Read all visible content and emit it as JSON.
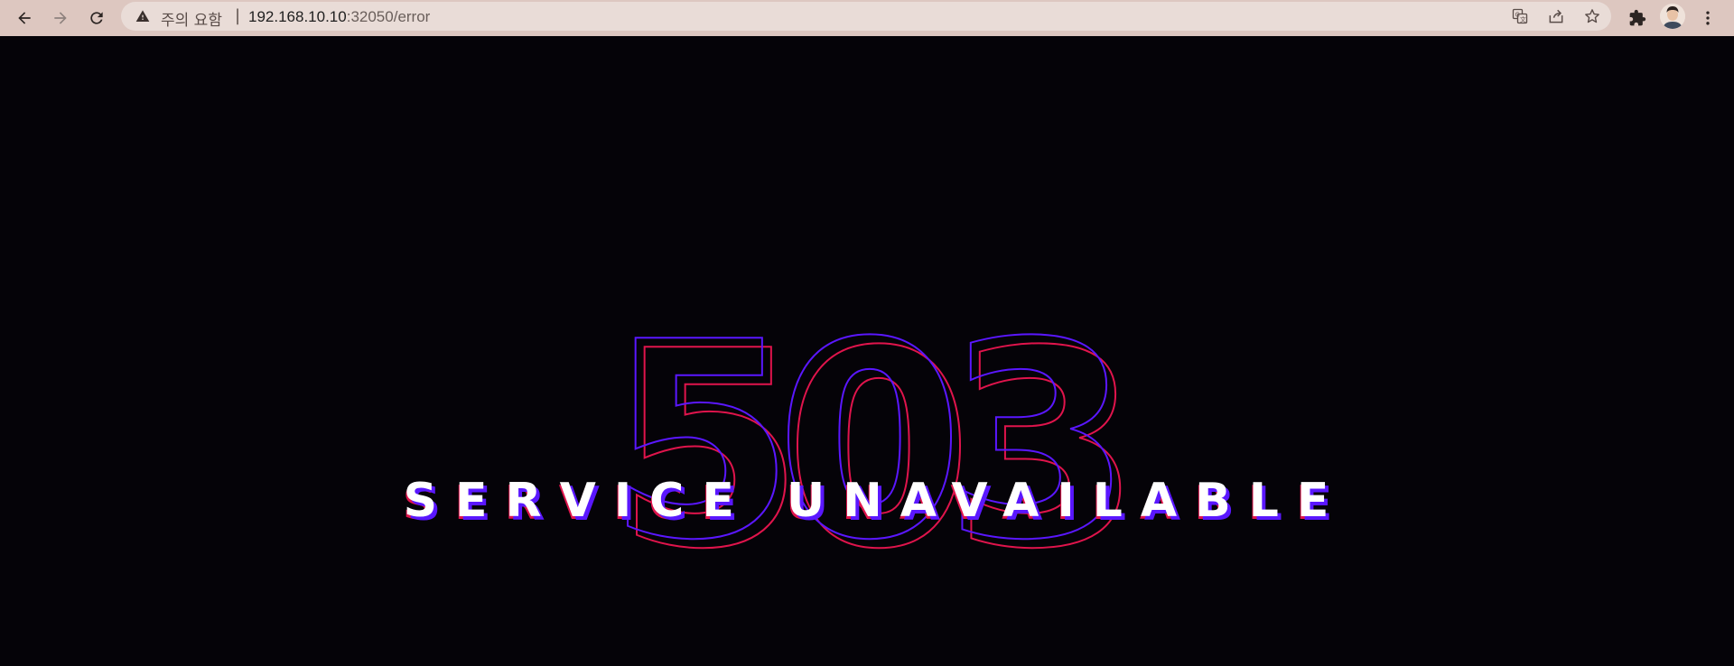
{
  "browser": {
    "security_label": "주의 요함",
    "separator": "|",
    "url_host": "192.168.10.10",
    "url_path": ":32050/error",
    "icons": {
      "back": "back-arrow-icon",
      "forward": "forward-arrow-icon",
      "reload": "reload-icon",
      "warning": "warning-icon",
      "translate": "translate-icon",
      "share": "share-icon",
      "bookmark": "star-icon",
      "extensions": "puzzle-icon",
      "menu": "kebab-menu-icon"
    }
  },
  "page": {
    "code": "503",
    "message": "SERVICE UNAVAILABLE",
    "colors": {
      "background": "#050308",
      "outline_primary": "#5a17ff",
      "outline_secondary": "#e0144c",
      "text": "#ffffff"
    }
  }
}
